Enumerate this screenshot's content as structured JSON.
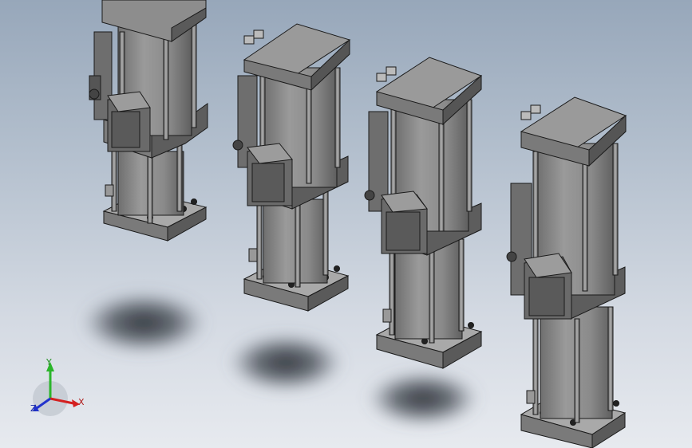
{
  "viewport": {
    "background_top": "#97a7ba",
    "background_bottom": "#e7eaef"
  },
  "model": {
    "part_type": "pneumatic-hydraulic booster cylinder",
    "instance_count": 4,
    "body_color": "#8c8c8c",
    "edge_color": "#1a1a1a"
  },
  "triad": {
    "x_label": "X",
    "y_label": "Y",
    "z_label": "Z",
    "x_color": "#d42020",
    "y_color": "#2bb52b",
    "z_color": "#2233cc"
  }
}
